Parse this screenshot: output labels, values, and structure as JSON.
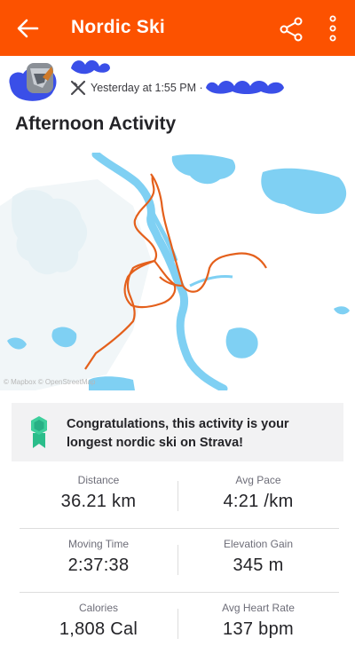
{
  "appbar": {
    "title": "Nordic Ski",
    "back_icon": "arrow-left-icon",
    "share_icon": "share-icon",
    "more_icon": "more-vertical-icon",
    "color": "#fc5200"
  },
  "header": {
    "timestamp": "Yesterday at 1:55 PM ·",
    "activity_icon": "nordic-ski-icon"
  },
  "activity": {
    "title": "Afternoon Activity"
  },
  "map": {
    "attribution": "© Mapbox © OpenStreetMap",
    "water_color": "#7fd0f3",
    "route_color": "#e4601c"
  },
  "banner": {
    "message": "Congratulations, this activity is your longest nordic ski on Strava!",
    "badge_icon": "achievement-badge-icon"
  },
  "stats": [
    {
      "left": {
        "label": "Distance",
        "value": "36.21 km"
      },
      "right": {
        "label": "Avg Pace",
        "value": "4:21 /km"
      }
    },
    {
      "left": {
        "label": "Moving Time",
        "value": "2:37:38"
      },
      "right": {
        "label": "Elevation Gain",
        "value": "345 m"
      }
    },
    {
      "left": {
        "label": "Calories",
        "value": "1,808 Cal"
      },
      "right": {
        "label": "Avg Heart Rate",
        "value": "137 bpm"
      }
    }
  ]
}
